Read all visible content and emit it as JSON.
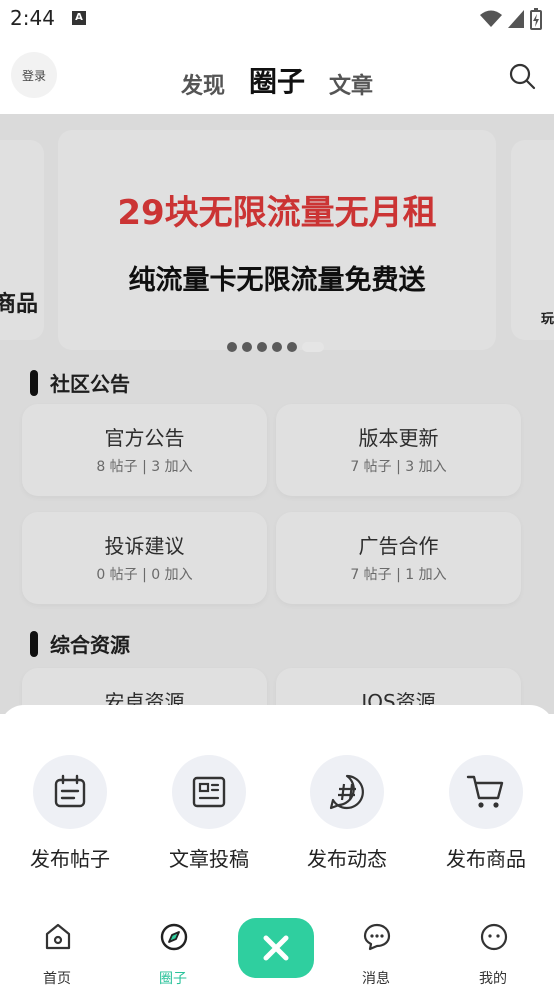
{
  "status": {
    "time": "2:44",
    "notif_letter": "A"
  },
  "header": {
    "login_label": "登录",
    "tabs": [
      {
        "label": "发现",
        "active": false
      },
      {
        "label": "圈子",
        "active": true
      },
      {
        "label": "文章",
        "active": false
      }
    ]
  },
  "banner": {
    "title": "29块无限流量无月租",
    "subtitle": "纯流量卡无限流量免费送",
    "left_peek_text": "商品",
    "right_peek_text": "玩"
  },
  "sections": [
    {
      "title": "社区公告",
      "cards": [
        {
          "title": "官方公告",
          "meta": "8 帖子 | 3 加入"
        },
        {
          "title": "版本更新",
          "meta": "7 帖子 | 3 加入"
        },
        {
          "title": "投诉建议",
          "meta": "0 帖子 | 0 加入"
        },
        {
          "title": "广告合作",
          "meta": "7 帖子 | 1 加入"
        }
      ]
    },
    {
      "title": "综合资源",
      "cards": [
        {
          "title": "安卓资源"
        },
        {
          "title": "IOS资源"
        }
      ]
    }
  ],
  "actions": [
    {
      "label": "发布帖子",
      "icon": "calendar-note-icon"
    },
    {
      "label": "文章投稿",
      "icon": "article-icon"
    },
    {
      "label": "发布动态",
      "icon": "hashtag-icon"
    },
    {
      "label": "发布商品",
      "icon": "cart-icon"
    }
  ],
  "bottom_nav": [
    {
      "label": "首页",
      "icon": "home-icon",
      "active": false
    },
    {
      "label": "圈子",
      "icon": "compass-icon",
      "active": true
    },
    {
      "label": "消息",
      "icon": "chat-icon",
      "active": false
    },
    {
      "label": "我的",
      "icon": "face-icon",
      "active": false
    }
  ],
  "colors": {
    "accent": "#2fcf9f",
    "banner_title": "#e23a3a"
  }
}
